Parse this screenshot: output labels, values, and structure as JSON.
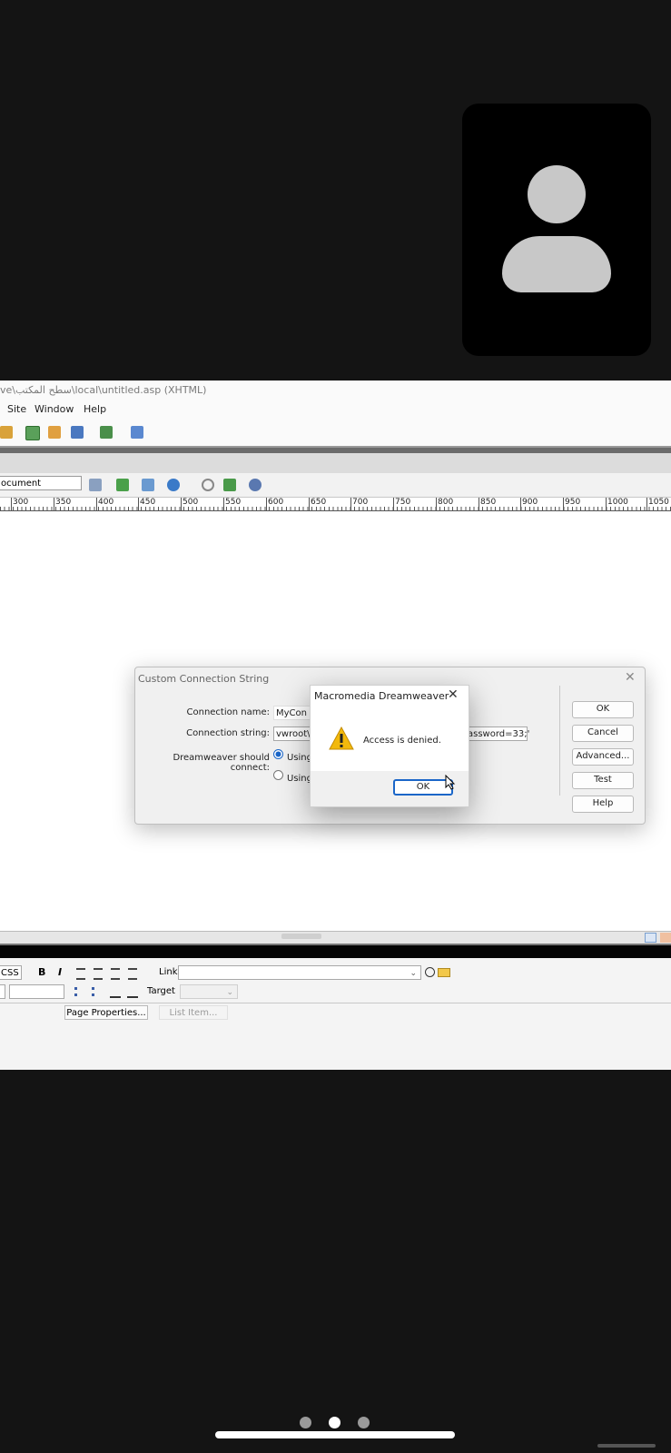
{
  "app": {
    "title": "ve\\سطح المكتب\\local\\untitled.asp (XHTML)",
    "menu": [
      "Site",
      "Window",
      "Help"
    ],
    "document_title_value": "ocument",
    "ruler_labels": [
      "300",
      "350",
      "400",
      "450",
      "500",
      "550",
      "600",
      "650",
      "700",
      "750",
      "800",
      "850",
      "900",
      "950",
      "1000",
      "1050"
    ]
  },
  "ccs_dialog": {
    "title": "Custom Connection String",
    "connection_name_label": "Connection name:",
    "connection_name_value": "MyCon",
    "connection_string_label": "Connection string:",
    "connection_string_value": "vwroot\\s",
    "connection_string_tail": "assword=33;'",
    "connect_label": "Dreamweaver should connect:",
    "radio1_label": "Using",
    "radio2_label": "Using",
    "buttons": {
      "ok": "OK",
      "cancel": "Cancel",
      "advanced": "Advanced...",
      "test": "Test",
      "help": "Help"
    }
  },
  "alert": {
    "title": "Macromedia Dreamweaver",
    "message": "Access is denied.",
    "ok_label": "OK"
  },
  "properties": {
    "css_value": "CSS",
    "bold": "B",
    "italic": "I",
    "link_label": "Link",
    "target_label": "Target",
    "page_properties": "Page Properties...",
    "list_item": "List Item..."
  },
  "colors": {
    "warning": "#f2b90c",
    "accent": "#1a66c8",
    "call_background": "#141414",
    "avatar": "#c8c8c8"
  },
  "page_dots_active": 2
}
